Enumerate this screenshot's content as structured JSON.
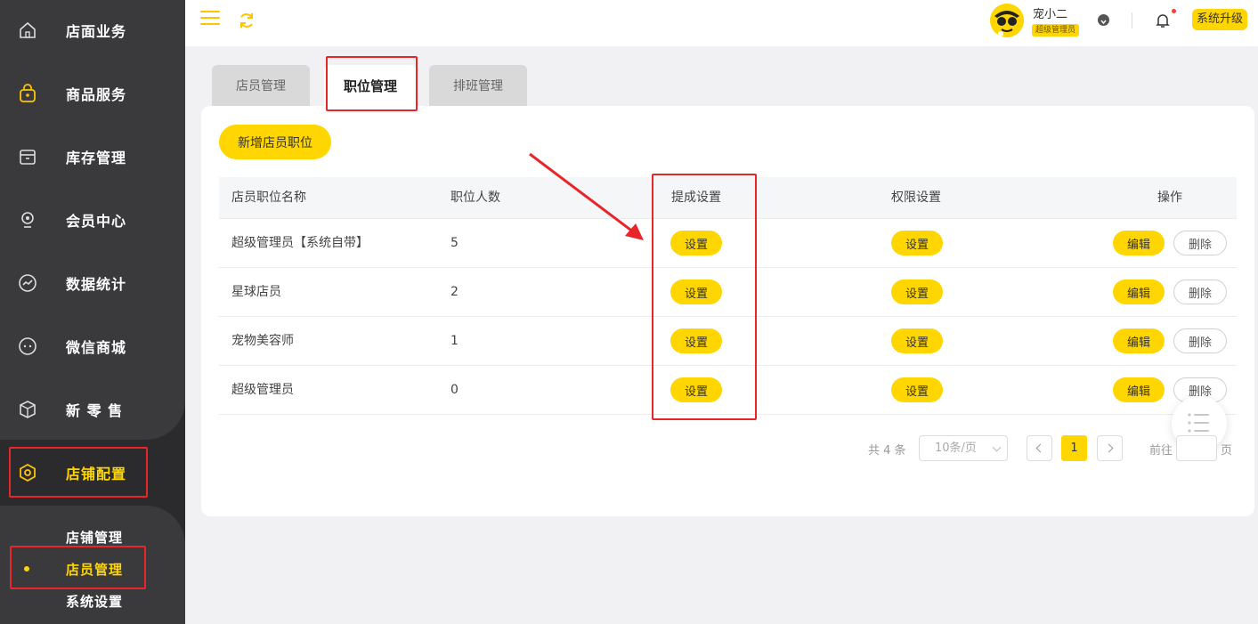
{
  "sidebar": {
    "items": [
      {
        "label": "店面业务",
        "icon": "home-icon"
      },
      {
        "label": "商品服务",
        "icon": "bag-icon"
      },
      {
        "label": "库存管理",
        "icon": "box-icon"
      },
      {
        "label": "会员中心",
        "icon": "user-icon"
      },
      {
        "label": "数据统计",
        "icon": "chart-icon"
      },
      {
        "label": "微信商城",
        "icon": "chat-icon"
      },
      {
        "label": "新 零 售",
        "icon": "cube-icon"
      },
      {
        "label": "店铺配置",
        "icon": "settings-icon",
        "active": true
      }
    ],
    "sub_items": [
      {
        "label": "店铺管理"
      },
      {
        "label": "店员管理",
        "active": true
      },
      {
        "label": "系统设置"
      }
    ]
  },
  "header": {
    "user_name": "宠小二",
    "user_role": "超级管理员",
    "upgrade_label": "系统升级"
  },
  "tabs": [
    {
      "label": "店员管理"
    },
    {
      "label": "职位管理",
      "active": true
    },
    {
      "label": "排班管理"
    }
  ],
  "main": {
    "add_button": "新增店员职位",
    "columns": [
      "店员职位名称",
      "职位人数",
      "提成设置",
      "权限设置",
      "操作"
    ],
    "rows": [
      {
        "name": "超级管理员【系统自带】",
        "count": "5",
        "commission": "设置",
        "permission": "设置",
        "edit": "编辑",
        "delete": "删除"
      },
      {
        "name": "星球店员",
        "count": "2",
        "commission": "设置",
        "permission": "设置",
        "edit": "编辑",
        "delete": "删除"
      },
      {
        "name": "宠物美容师",
        "count": "1",
        "commission": "设置",
        "permission": "设置",
        "edit": "编辑",
        "delete": "删除"
      },
      {
        "name": "超级管理员",
        "count": "0",
        "commission": "设置",
        "permission": "设置",
        "edit": "编辑",
        "delete": "删除"
      }
    ]
  },
  "pagination": {
    "total": "共 4 条",
    "page_size": "10条/页",
    "current_page": "1",
    "goto_label": "前往",
    "page_suffix": "页"
  },
  "colors": {
    "accent": "#ffd600",
    "sidebar_bg": "#2b2b2e",
    "annotation_red": "#e8262a"
  }
}
